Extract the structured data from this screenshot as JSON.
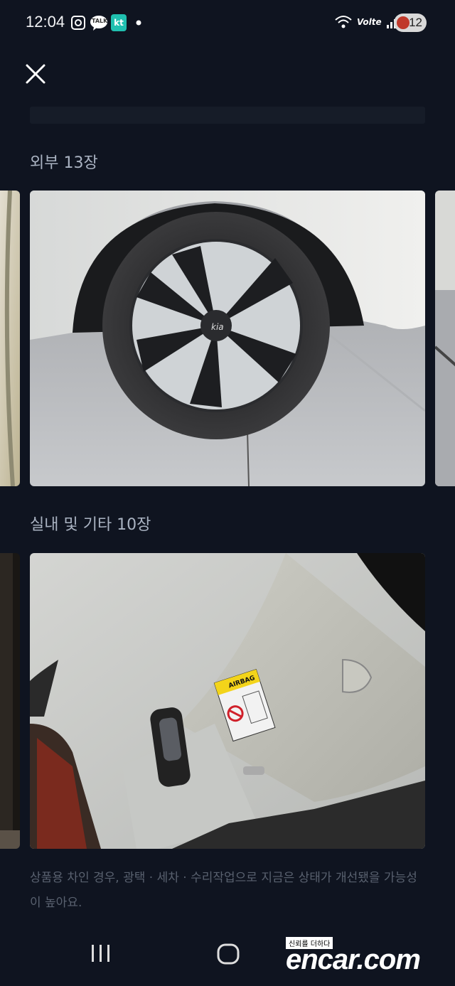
{
  "status_bar": {
    "time": "12:04",
    "talk_badge": "TALK",
    "kt_badge": "kt",
    "network": "Volte",
    "battery": "12"
  },
  "close_label": "close",
  "sections": [
    {
      "title": "외부 13장"
    },
    {
      "title": "실내 및 기타 10장"
    }
  ],
  "note": "상품용 차인 경우, 광택 · 세차 · 수리작업으로 지금은 상태가 개선됐을 가능성이 높아요.",
  "watermark": {
    "tagline": "신뢰를 더하다",
    "brand": "encar.com"
  },
  "colors": {
    "background": "#0f1420",
    "title_text": "#aab3c2",
    "note_text": "#59616f"
  }
}
